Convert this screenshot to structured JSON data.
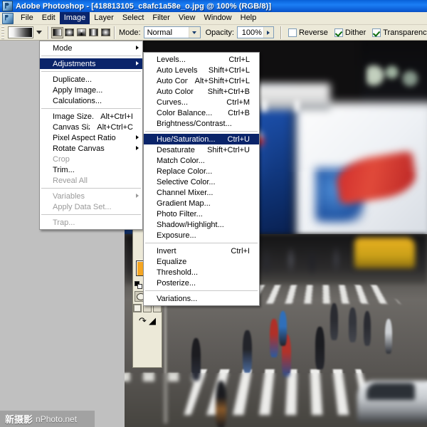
{
  "window": {
    "app_name": "Adobe Photoshop",
    "title": "Adobe Photoshop - [418813105_c8afc1a58e_o.jpg @ 100% (RGB/8)]",
    "document_name": "418813105_c8afc1a58e_o.jpg",
    "zoom": "100%",
    "color_mode": "RGB/8"
  },
  "menubar": {
    "items": [
      {
        "label": "File",
        "active": false
      },
      {
        "label": "Edit",
        "active": false
      },
      {
        "label": "Image",
        "active": true
      },
      {
        "label": "Layer",
        "active": false
      },
      {
        "label": "Select",
        "active": false
      },
      {
        "label": "Filter",
        "active": false
      },
      {
        "label": "View",
        "active": false
      },
      {
        "label": "Window",
        "active": false
      },
      {
        "label": "Help",
        "active": false
      }
    ]
  },
  "options_bar": {
    "mode_label": "Mode:",
    "mode_value": "Normal",
    "opacity_label": "Opacity:",
    "opacity_value": "100%",
    "reverse_label": "Reverse",
    "reverse_checked": false,
    "dither_label": "Dither",
    "dither_checked": true,
    "transparency_label": "Transparency",
    "transparency_checked": true
  },
  "toolbox": {
    "tools": [
      "move-tool",
      "eyedropper-tool",
      "notes-tool",
      "hand-tool"
    ],
    "foreground_color": "#f5a623",
    "background_color": "#7b7b7b",
    "quickmask_standard": "standard-mode",
    "quickmask_mask": "quick-mask-mode",
    "screen_modes": [
      "standard-screen-mode",
      "full-screen-with-menubar",
      "full-screen"
    ],
    "jump_to": [
      "jump-to-imageready",
      "jump-to-file"
    ]
  },
  "image_menu": {
    "items": [
      {
        "label": "Mode",
        "accel": "",
        "submenu": true,
        "disabled": false,
        "highlight": false
      },
      {
        "type": "separator"
      },
      {
        "label": "Adjustments",
        "accel": "",
        "submenu": true,
        "disabled": false,
        "highlight": true
      },
      {
        "type": "separator"
      },
      {
        "label": "Duplicate...",
        "accel": "",
        "submenu": false,
        "disabled": false,
        "highlight": false
      },
      {
        "label": "Apply Image...",
        "accel": "",
        "submenu": false,
        "disabled": false,
        "highlight": false
      },
      {
        "label": "Calculations...",
        "accel": "",
        "submenu": false,
        "disabled": false,
        "highlight": false
      },
      {
        "type": "separator"
      },
      {
        "label": "Image Size...",
        "accel": "Alt+Ctrl+I",
        "submenu": false,
        "disabled": false,
        "highlight": false
      },
      {
        "label": "Canvas Size...",
        "accel": "Alt+Ctrl+C",
        "submenu": false,
        "disabled": false,
        "highlight": false
      },
      {
        "label": "Pixel Aspect Ratio",
        "accel": "",
        "submenu": true,
        "disabled": false,
        "highlight": false
      },
      {
        "label": "Rotate Canvas",
        "accel": "",
        "submenu": true,
        "disabled": false,
        "highlight": false
      },
      {
        "label": "Crop",
        "accel": "",
        "submenu": false,
        "disabled": true,
        "highlight": false
      },
      {
        "label": "Trim...",
        "accel": "",
        "submenu": false,
        "disabled": false,
        "highlight": false
      },
      {
        "label": "Reveal All",
        "accel": "",
        "submenu": false,
        "disabled": true,
        "highlight": false
      },
      {
        "type": "separator"
      },
      {
        "label": "Variables",
        "accel": "",
        "submenu": true,
        "disabled": true,
        "highlight": false
      },
      {
        "label": "Apply Data Set...",
        "accel": "",
        "submenu": false,
        "disabled": true,
        "highlight": false
      },
      {
        "type": "separator"
      },
      {
        "label": "Trap...",
        "accel": "",
        "submenu": false,
        "disabled": true,
        "highlight": false
      }
    ]
  },
  "adjustments_menu": {
    "items": [
      {
        "label": "Levels...",
        "accel": "Ctrl+L",
        "highlight": false
      },
      {
        "label": "Auto Levels",
        "accel": "Shift+Ctrl+L",
        "highlight": false
      },
      {
        "label": "Auto Contrast",
        "accel": "Alt+Shift+Ctrl+L",
        "highlight": false
      },
      {
        "label": "Auto Color",
        "accel": "Shift+Ctrl+B",
        "highlight": false
      },
      {
        "label": "Curves...",
        "accel": "Ctrl+M",
        "highlight": false
      },
      {
        "label": "Color Balance...",
        "accel": "Ctrl+B",
        "highlight": false
      },
      {
        "label": "Brightness/Contrast...",
        "accel": "",
        "highlight": false
      },
      {
        "type": "separator"
      },
      {
        "label": "Hue/Saturation...",
        "accel": "Ctrl+U",
        "highlight": true
      },
      {
        "label": "Desaturate",
        "accel": "Shift+Ctrl+U",
        "highlight": false
      },
      {
        "label": "Match Color...",
        "accel": "",
        "highlight": false
      },
      {
        "label": "Replace Color...",
        "accel": "",
        "highlight": false
      },
      {
        "label": "Selective Color...",
        "accel": "",
        "highlight": false
      },
      {
        "label": "Channel Mixer...",
        "accel": "",
        "highlight": false
      },
      {
        "label": "Gradient Map...",
        "accel": "",
        "highlight": false
      },
      {
        "label": "Photo Filter...",
        "accel": "",
        "highlight": false
      },
      {
        "label": "Shadow/Highlight...",
        "accel": "",
        "highlight": false
      },
      {
        "label": "Exposure...",
        "accel": "",
        "highlight": false
      },
      {
        "type": "separator"
      },
      {
        "label": "Invert",
        "accel": "Ctrl+I",
        "highlight": false
      },
      {
        "label": "Equalize",
        "accel": "",
        "highlight": false
      },
      {
        "label": "Threshold...",
        "accel": "",
        "highlight": false
      },
      {
        "label": "Posterize...",
        "accel": "",
        "highlight": false
      },
      {
        "type": "separator"
      },
      {
        "label": "Variations...",
        "accel": "",
        "highlight": false
      }
    ]
  },
  "watermark": {
    "chinese": "新摄影",
    "english": "nPhoto.net"
  }
}
